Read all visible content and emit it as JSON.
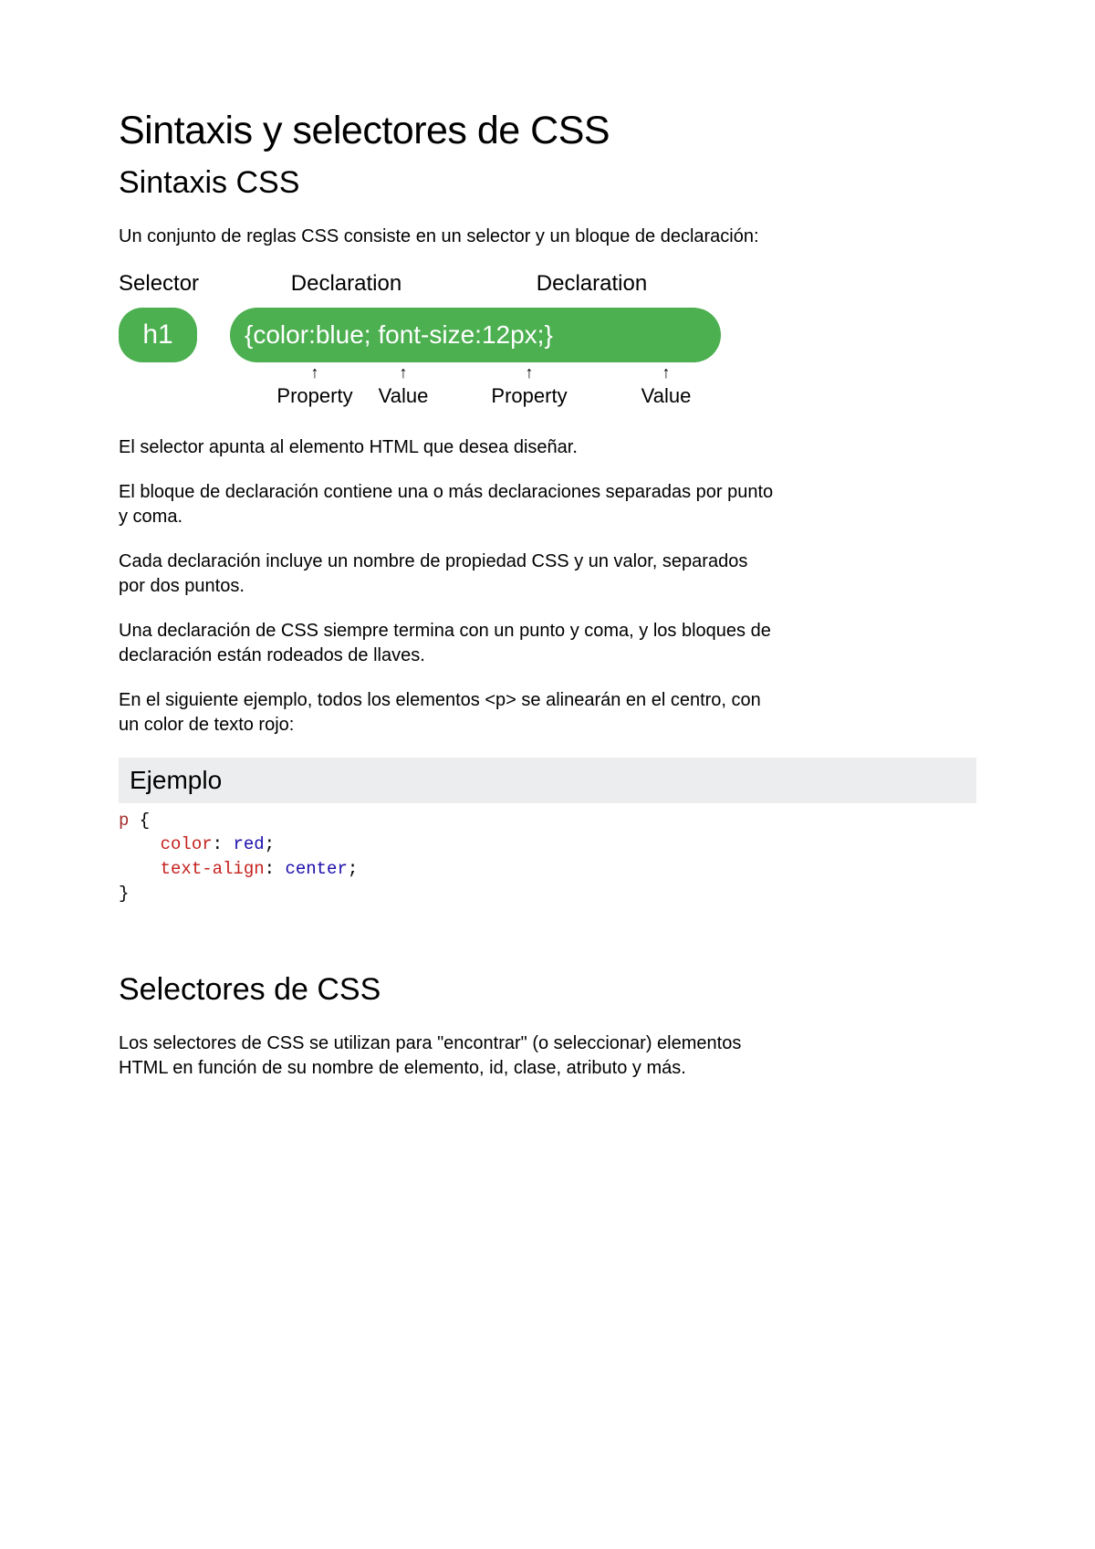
{
  "title": "Sintaxis y selectores de CSS",
  "section1": {
    "heading": "Sintaxis CSS",
    "intro": "Un conjunto de reglas CSS consiste en un selector y un bloque de declaración:",
    "diagram": {
      "labels": {
        "selector": "Selector",
        "declaration1": "Declaration",
        "declaration2": "Declaration",
        "property": "Property",
        "value": "Value"
      },
      "selector_text": "h1",
      "brace_open": "{",
      "decl1_prop": "color",
      "decl1_sep": ":",
      "decl1_val": "blue",
      "decl1_end": ";",
      "space": " ",
      "decl2_prop": "font-size",
      "decl2_sep": ":",
      "decl2_val": "12px",
      "decl2_end": ";",
      "brace_close": "}",
      "arrow": "↑"
    },
    "para2": "El selector apunta al elemento HTML que desea diseñar.",
    "para3": "El bloque de declaración contiene una o más declaraciones separadas por punto y coma.",
    "para4": "Cada declaración incluye un nombre de propiedad CSS y un valor, separados por dos puntos.",
    "para5": "Una declaración de CSS siempre termina con un punto y coma, y los bloques de declaración están rodeados de llaves.",
    "para6": "En el siguiente ejemplo, todos los elementos <p> se alinearán en el centro, con un color de texto rojo:"
  },
  "example1": {
    "heading": "Ejemplo",
    "line1_sel": "p",
    "line1_brace": " {",
    "indent": "    ",
    "line2_prop": "color",
    "line2_colon": ": ",
    "line2_val": "red",
    "line2_semi": ";",
    "line3_prop": "text-align",
    "line3_colon": ": ",
    "line3_val": "center",
    "line3_semi": ";",
    "line4_brace": "}"
  },
  "section2": {
    "heading": "Selectores de CSS",
    "para1": "Los selectores de CSS se utilizan para \"encontrar\" (o seleccionar) elementos HTML en función de su nombre de elemento, id, clase, atributo y más."
  }
}
